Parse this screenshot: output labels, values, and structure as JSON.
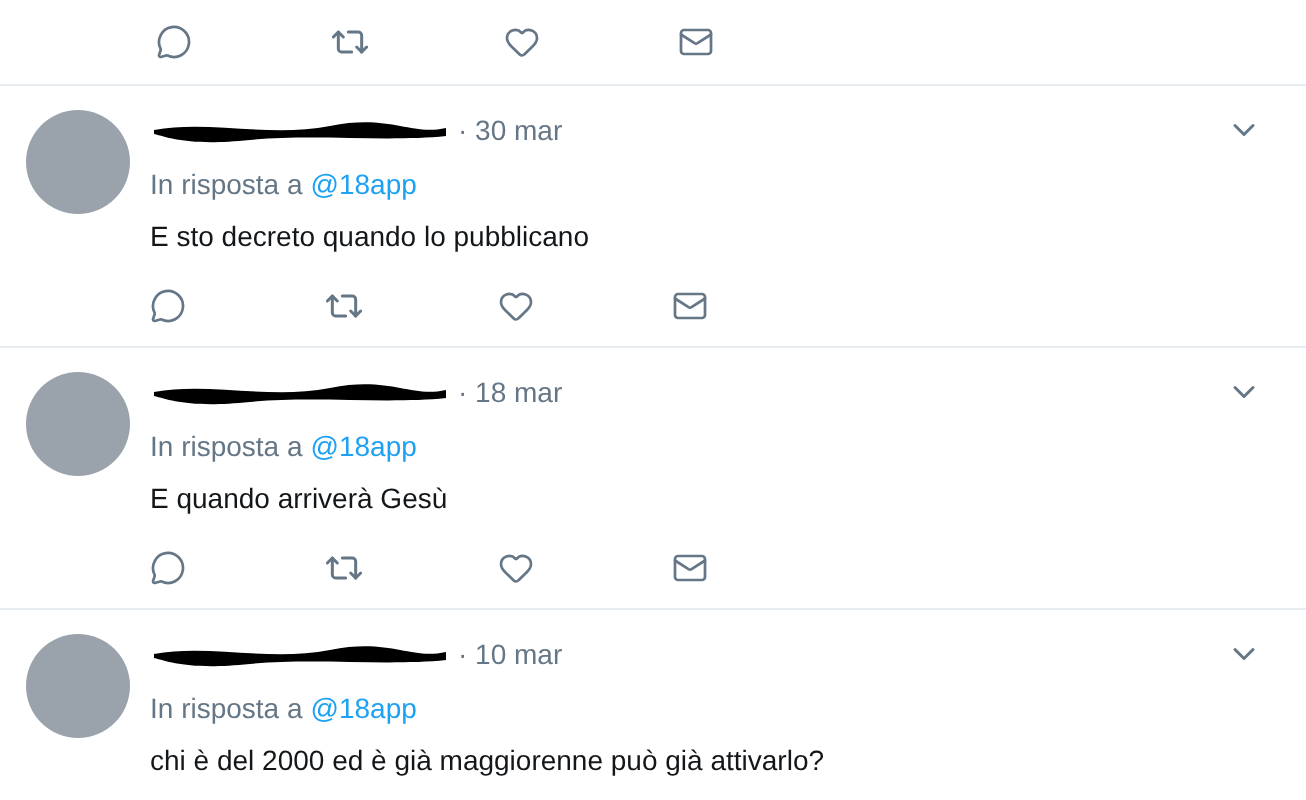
{
  "tweets": [
    {
      "date": "· 30 mar",
      "reply_prefix": "In risposta a",
      "reply_handle": "@18app",
      "text": "E sto decreto quando lo pubblicano"
    },
    {
      "date": "· 18 mar",
      "reply_prefix": "In risposta a",
      "reply_handle": "@18app",
      "text": "E quando arriverà Gesù"
    },
    {
      "date": "· 10 mar",
      "reply_prefix": "In risposta a",
      "reply_handle": "@18app",
      "text": "chi è del 2000 ed è già maggiorenne può già attivarlo?"
    }
  ]
}
